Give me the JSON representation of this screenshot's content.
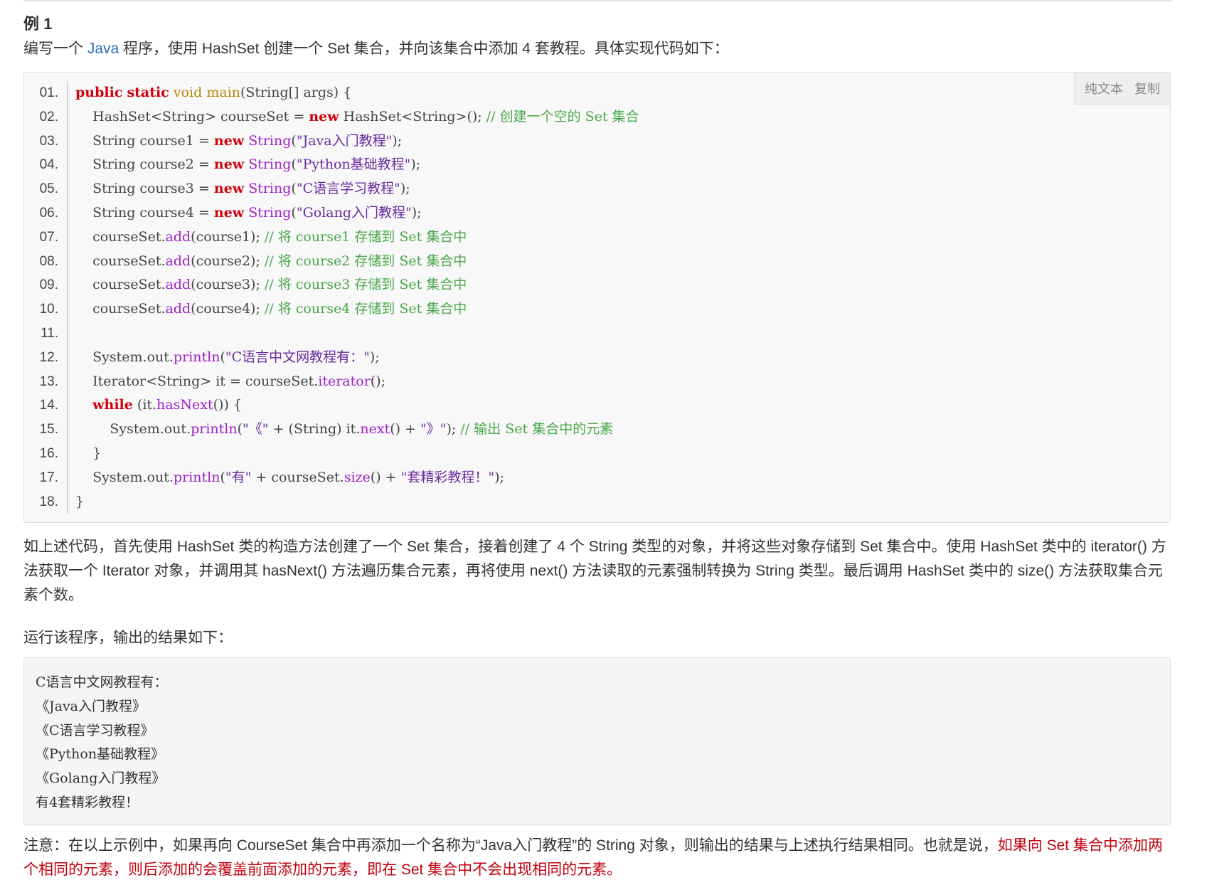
{
  "heading": "例 1",
  "intro": {
    "before": "编写一个 ",
    "link": "Java",
    "after": " 程序，使用 HashSet 创建一个 Set 集合，并向该集合中添加 4 套教程。具体实现代码如下："
  },
  "code_toolbar": {
    "plain_text": "纯文本",
    "copy": "复制"
  },
  "code": {
    "line_numbers": [
      "01.",
      "02.",
      "03.",
      "04.",
      "05.",
      "06.",
      "07.",
      "08.",
      "09.",
      "10.",
      "11.",
      "12.",
      "13.",
      "14.",
      "15.",
      "16.",
      "17.",
      "18."
    ],
    "lines": [
      "public static void main(String[] args) {",
      "    HashSet<String> courseSet = new HashSet<String>(); // 创建一个空的 Set 集合",
      "    String course1 = new String(\"Java入门教程\");",
      "    String course2 = new String(\"Python基础教程\");",
      "    String course3 = new String(\"C语言学习教程\");",
      "    String course4 = new String(\"Golang入门教程\");",
      "    courseSet.add(course1); // 将 course1 存储到 Set 集合中",
      "    courseSet.add(course2); // 将 course2 存储到 Set 集合中",
      "    courseSet.add(course3); // 将 course3 存储到 Set 集合中",
      "    courseSet.add(course4); // 将 course4 存储到 Set 集合中",
      "",
      "    System.out.println(\"C语言中文网教程有：\");",
      "    Iterator<String> it = courseSet.iterator();",
      "    while (it.hasNext()) {",
      "        System.out.println(\"《\" + (String) it.next() + \"》\"); // 输出 Set 集合中的元素",
      "    }",
      "    System.out.println(\"有\" + courseSet.size() + \"套精彩教程！\");",
      "}"
    ]
  },
  "explanation": "如上述代码，首先使用 HashSet 类的构造方法创建了一个 Set 集合，接着创建了 4 个 String 类型的对象，并将这些对象存储到 Set 集合中。使用 HashSet 类中的 iterator() 方法获取一个 Iterator 对象，并调用其 hasNext() 方法遍历集合元素，再将使用 next() 方法读取的元素强制转换为 String 类型。最后调用 HashSet 类中的 size() 方法获取集合元素个数。",
  "run_intro": "运行该程序，输出的结果如下：",
  "output": [
    "C语言中文网教程有：",
    "《Java入门教程》",
    "《C语言学习教程》",
    "《Python基础教程》",
    "《Golang入门教程》",
    "有4套精彩教程！"
  ],
  "note": {
    "normal": "注意：在以上示例中，如果再向 CourseSet 集合中再添加一个名称为“Java入门教程”的 String 对象，则输出的结果与上述执行结果相同。也就是说，",
    "highlight": "如果向 Set 集合中添加两个相同的元素，则后添加的会覆盖前面添加的元素，即在 Set 集合中不会出现相同的元素。"
  },
  "colors": {
    "keyword": "#d0000e",
    "type": "#b8860b",
    "method": "#a020c8",
    "comment": "#4aa84a",
    "link": "#2a6ebb",
    "highlight": "#c0000c"
  }
}
